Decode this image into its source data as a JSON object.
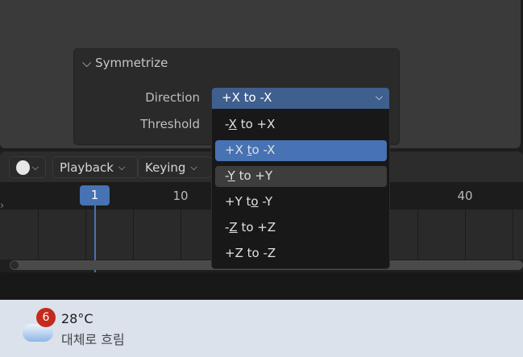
{
  "panel": {
    "title": "Symmetrize",
    "direction_label": "Direction",
    "threshold_label": "Threshold"
  },
  "dropdown": {
    "value": "+X to -X",
    "options": [
      {
        "pre": "-",
        "key": "X",
        "post": " to +X"
      },
      {
        "pre": "+X ",
        "key": "t",
        "post": "o -X"
      },
      {
        "pre": "-",
        "key": "Y",
        "post": " to +Y"
      },
      {
        "pre": "+Y t",
        "key": "o",
        "post": " -Y"
      },
      {
        "pre": "-",
        "key": "Z",
        "post": " to +Z"
      },
      {
        "pre": "+Z to -Z",
        "key": "",
        "post": ""
      }
    ],
    "selected_index": 1,
    "hover_index": 2
  },
  "timeline": {
    "playback": "Playback",
    "keying": "Keying",
    "current_frame": "1",
    "frames": [
      "10",
      "40"
    ]
  },
  "colors": {
    "accent": "#4772b3"
  },
  "taskbar": {
    "weather_temp": "28°C",
    "weather_desc": "대체로 흐림",
    "badge": "6"
  }
}
